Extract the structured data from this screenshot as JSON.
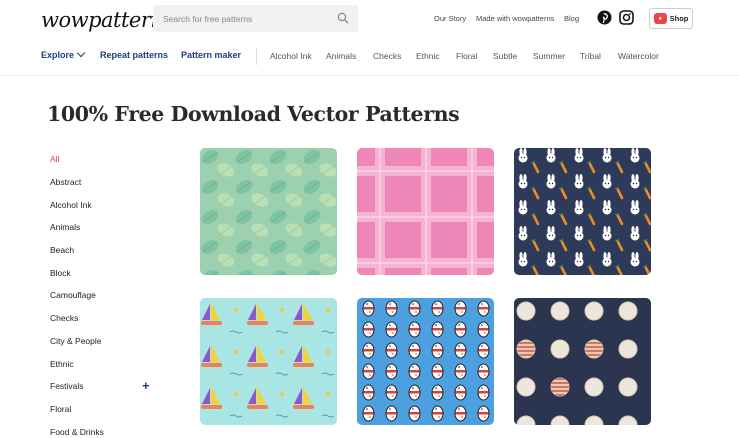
{
  "header": {
    "logo": "wowpatterns",
    "search": {
      "placeholder": "Search for free patterns"
    },
    "top_links": [
      "Our Story",
      "Made with wowpatterns",
      "Blog"
    ],
    "shop_label": "Shop"
  },
  "nav": {
    "explore": "Explore",
    "repeat": "Repeat patterns",
    "maker": "Pattern maker",
    "categories": [
      "Alcohol Ink",
      "Animals",
      "Checks",
      "Ethnic",
      "Floral",
      "Subtle",
      "Summer",
      "Tribal",
      "Watercolor"
    ]
  },
  "page_title": "100% Free Download Vector Patterns",
  "sidebar": {
    "items": [
      "All",
      "Abstract",
      "Alcohol Ink",
      "Animals",
      "Beach",
      "Block",
      "Camouflage",
      "Checks",
      "City & People",
      "Ethnic",
      "Festivals",
      "Floral",
      "Food & Drinks"
    ],
    "active": "All"
  },
  "colors": {
    "accent": "#e8474c",
    "nav": "#1d3f80"
  }
}
